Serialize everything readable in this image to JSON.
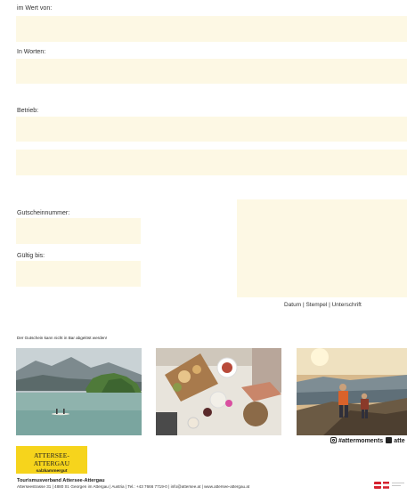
{
  "form": {
    "label_value": "im Wert von:",
    "label_words": "In Worten:",
    "label_business": "Betrieb:",
    "label_voucher_number": "Gutscheinnummer:",
    "label_valid_until": "Gültig bis:",
    "signature_caption": "Datum | Stempel | Unterschrift"
  },
  "notice": "Der Gutschein kann nicht in Bar abgelöst werden!",
  "social": {
    "hashtag": "#attermoments",
    "facebook_cut": "atte",
    "icon_instagram": "instagram-icon",
    "icon_facebook": "facebook-icon"
  },
  "logo": {
    "line1": "ATTERSEE-ATTERGAU",
    "line2": "salzkammergut"
  },
  "footer": {
    "org": "Tourismusverband Attersee-Attergau",
    "address": "Atterseestrasse 31 | 4880 St. Georgen im Attergau | Austria | Tel.: +43 7666 7719-0 | info@attersee.at | www.attersee-attergau.at"
  },
  "colors": {
    "field_bg": "#fdf8e4",
    "logo_bg": "#f6d41c",
    "austria_red": "#d6232f"
  }
}
